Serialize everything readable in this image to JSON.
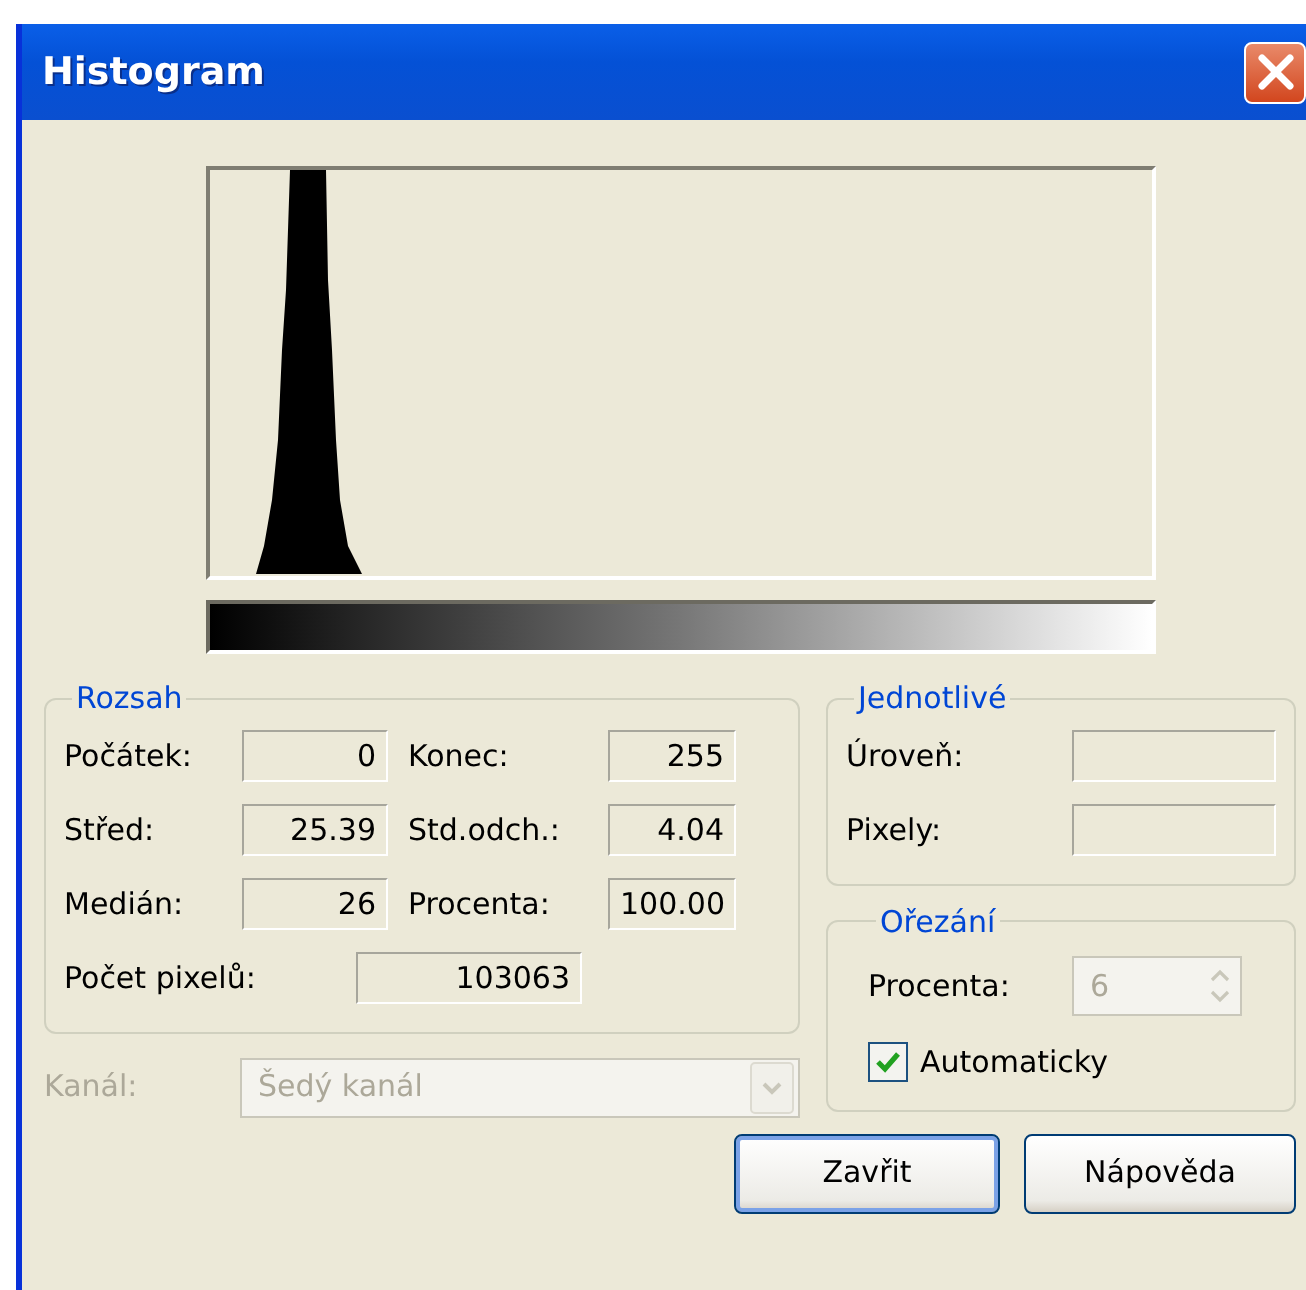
{
  "window": {
    "title": "Histogram"
  },
  "range": {
    "title": "Rozsah",
    "rows": [
      {
        "cells": [
          {
            "label": "Počátek:",
            "value": "0"
          },
          {
            "label": "Konec:",
            "value": "255"
          }
        ]
      },
      {
        "cells": [
          {
            "label": "Střed:",
            "value": "25.39"
          },
          {
            "label": "Std.odch.:",
            "value": "4.04"
          }
        ]
      },
      {
        "cells": [
          {
            "label": "Medián:",
            "value": "26"
          },
          {
            "label": "Procenta:",
            "value": "100.00"
          }
        ]
      },
      {
        "cells": [
          {
            "label": "Počet pixelů:",
            "value": "103063"
          }
        ]
      }
    ]
  },
  "channel": {
    "label": "Kanál:",
    "value": "Šedý kanál",
    "disabled": true
  },
  "single": {
    "title": "Jednotlivé",
    "fields": [
      {
        "label": "Úroveň:"
      },
      {
        "label": "Pixely:"
      }
    ]
  },
  "clipping": {
    "title": "Ořezání",
    "percent": {
      "label": "Procenta:",
      "value": "6",
      "disabled": true
    },
    "automatic": {
      "label": "Automaticky",
      "checked": true
    }
  },
  "buttons": [
    {
      "label": "Zavřit",
      "focused": true
    },
    {
      "label": "Nápověda",
      "focused": false
    }
  ]
}
